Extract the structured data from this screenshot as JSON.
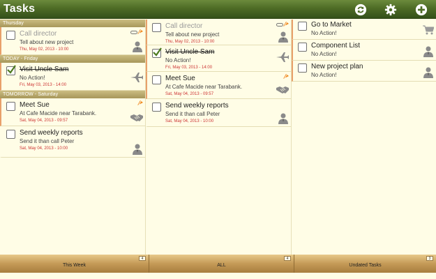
{
  "header": {
    "title": "Tasks"
  },
  "columns": [
    {
      "sections": [
        {
          "label": "Thursday",
          "tasks": [
            {
              "title": "Call director",
              "desc": "Tell about new project",
              "date": "Thu, May 02, 2013 - 10:00"
            }
          ]
        },
        {
          "label": "TODAY - Friday",
          "tasks": [
            {
              "title": "Visit Uncle Sam",
              "desc": "No Action!",
              "date": "Fri, May 03, 2013 - 14:00"
            }
          ]
        },
        {
          "label": "TOMORROW - Saturday",
          "tasks": [
            {
              "title": "Meet Sue",
              "desc": "At Cafe Macide near Tarabank.",
              "date": "Sat, May 04, 2013 - 09:57"
            },
            {
              "title": "Send weekly reports",
              "desc": "Send it than call Peter",
              "date": "Sat, May 04, 2013 - 10:00"
            }
          ]
        }
      ]
    },
    {
      "tasks": [
        {
          "title": "Call director",
          "desc": "Tell about new project",
          "date": "Thu, May 02, 2013 - 10:00"
        },
        {
          "title": "Visit Uncle Sam",
          "desc": "No Action!",
          "date": "Fri, May 03, 2013 - 14:00"
        },
        {
          "title": "Meet Sue",
          "desc": "At Cafe Macide near Tarabank.",
          "date": "Sat, May 04, 2013 - 09:57"
        },
        {
          "title": "Send weekly reports",
          "desc": "Send it than call Peter",
          "date": "Sat, May 04, 2013 - 10:00"
        }
      ]
    },
    {
      "tasks": [
        {
          "title": "Go to Market",
          "desc": "No Action!"
        },
        {
          "title": "Component List",
          "desc": "No Action!"
        },
        {
          "title": "New project plan",
          "desc": "No Action!"
        }
      ]
    }
  ],
  "footer": {
    "tabs": [
      {
        "label": "This Week",
        "badge": "4"
      },
      {
        "label": "ALL",
        "badge": "4"
      },
      {
        "label": "Undated Tasks",
        "badge": "3"
      }
    ]
  },
  "colors": {
    "header": "#4e6c26",
    "accent_border": "#e8a06a",
    "date_text": "#cc3333",
    "footer_tab": "#c49a57"
  }
}
